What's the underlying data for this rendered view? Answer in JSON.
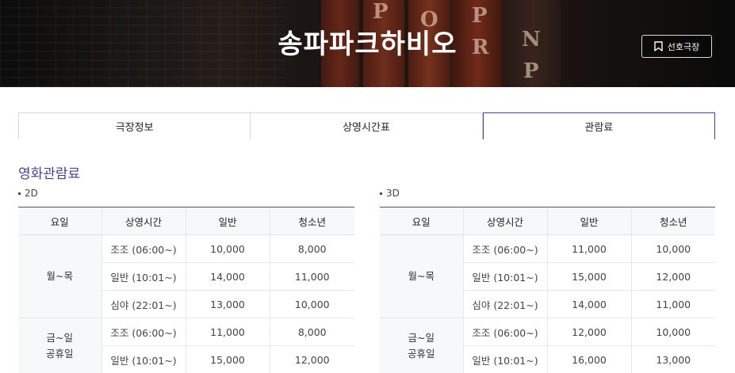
{
  "hero": {
    "title": "송파파크하비오",
    "favorite_label": "선호극장",
    "background_letters": [
      "P",
      "O",
      "P",
      "N",
      "R",
      "P"
    ]
  },
  "tabs": [
    {
      "label": "극장정보",
      "active": false
    },
    {
      "label": "상영시간표",
      "active": false
    },
    {
      "label": "관람료",
      "active": true
    }
  ],
  "section": {
    "title": "영화관람료"
  },
  "tables": [
    {
      "label": "2D",
      "headers": [
        "요일",
        "상영시간",
        "일반",
        "청소년"
      ],
      "groups": [
        {
          "day_lines": [
            "월~목"
          ],
          "rows": [
            {
              "time": "조조 (06:00~)",
              "general": "10,000",
              "youth": "8,000"
            },
            {
              "time": "일반 (10:01~)",
              "general": "14,000",
              "youth": "11,000"
            },
            {
              "time": "심야 (22:01~)",
              "general": "13,000",
              "youth": "10,000"
            }
          ]
        },
        {
          "day_lines": [
            "금~일",
            "공휴일"
          ],
          "rows": [
            {
              "time": "조조 (06:00~)",
              "general": "11,000",
              "youth": "8,000"
            },
            {
              "time": "일반 (10:01~)",
              "general": "15,000",
              "youth": "12,000"
            }
          ]
        }
      ]
    },
    {
      "label": "3D",
      "headers": [
        "요일",
        "상영시간",
        "일반",
        "청소년"
      ],
      "groups": [
        {
          "day_lines": [
            "월~목"
          ],
          "rows": [
            {
              "time": "조조 (06:00~)",
              "general": "11,000",
              "youth": "10,000"
            },
            {
              "time": "일반 (10:01~)",
              "general": "15,000",
              "youth": "12,000"
            },
            {
              "time": "심야 (22:01~)",
              "general": "14,000",
              "youth": "11,000"
            }
          ]
        },
        {
          "day_lines": [
            "금~일",
            "공휴일"
          ],
          "rows": [
            {
              "time": "조조 (06:00~)",
              "general": "12,000",
              "youth": "10,000"
            },
            {
              "time": "일반 (10:01~)",
              "general": "16,000",
              "youth": "13,000"
            }
          ]
        }
      ]
    }
  ],
  "colors": {
    "accent": "#4a3f8c",
    "header_bg": "#f7f8f9",
    "hero_dark": "#1a1a1a"
  }
}
